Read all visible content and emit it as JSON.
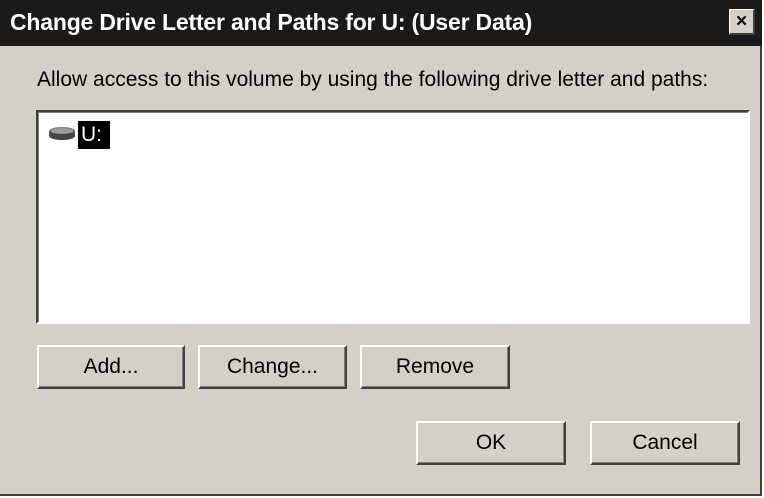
{
  "window": {
    "title": "Change Drive Letter and Paths for U: (User Data)",
    "close_label": "×"
  },
  "instruction": "Allow access to this volume by using the following drive letter and paths:",
  "list": {
    "items": [
      {
        "label": "U:",
        "icon": "drive-icon",
        "selected": true
      }
    ]
  },
  "buttons": {
    "add": "Add...",
    "change": "Change...",
    "remove": "Remove",
    "ok": "OK",
    "cancel": "Cancel"
  },
  "colors": {
    "titlebar": "#1a1a1a",
    "dialog_bg": "#d4d0c8",
    "selection": "#000000"
  }
}
